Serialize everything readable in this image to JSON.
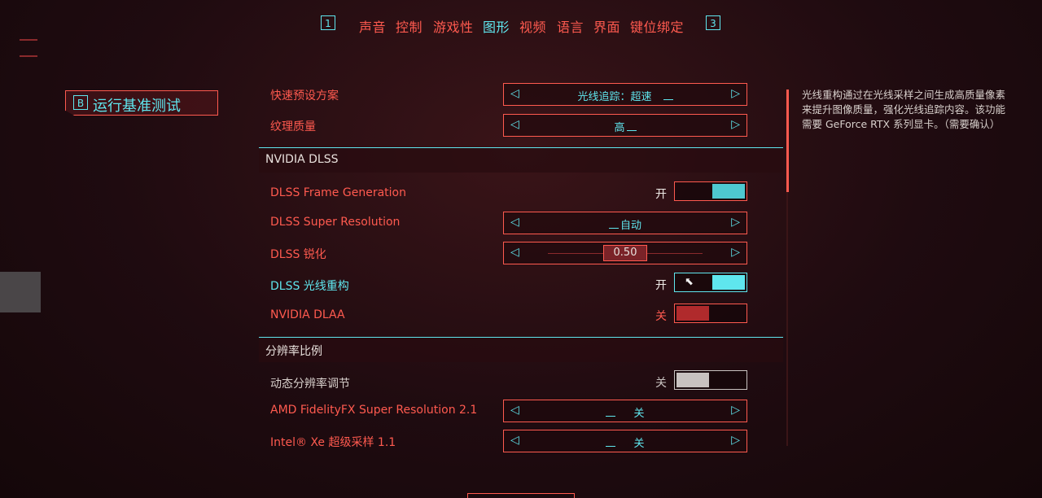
{
  "top_nav": {
    "prev_key": "1",
    "next_key": "3",
    "tabs": [
      {
        "label": "声音"
      },
      {
        "label": "控制"
      },
      {
        "label": "游戏性"
      },
      {
        "label": "图形",
        "active": true
      },
      {
        "label": "视频"
      },
      {
        "label": "语言"
      },
      {
        "label": "界面"
      },
      {
        "label": "键位绑定"
      }
    ]
  },
  "benchmark": {
    "key": "B",
    "label": "运行基准测试"
  },
  "settings": {
    "quick_preset": {
      "label": "快速预设方案",
      "value": "光线追踪：超速"
    },
    "texture_quality": {
      "label": "纹理质量",
      "value": "高"
    },
    "dlss_section": {
      "title": "NVIDIA DLSS"
    },
    "dlss_frame_gen": {
      "label": "DLSS Frame Generation",
      "state": "开"
    },
    "dlss_super_res": {
      "label": "DLSS Super Resolution",
      "value": "自动"
    },
    "dlss_sharpen": {
      "label": "DLSS 锐化",
      "value": "0.50"
    },
    "dlss_ray_recon": {
      "label": "DLSS 光线重构",
      "state": "开"
    },
    "nvidia_dlaa": {
      "label": "NVIDIA DLAA",
      "state": "关"
    },
    "resolution_section": {
      "title": "分辨率比例"
    },
    "dynamic_res": {
      "label": "动态分辨率调节",
      "state": "关"
    },
    "amd_fsr": {
      "label": "AMD FidelityFX Super Resolution 2.1",
      "value": "关"
    },
    "intel_xess": {
      "label": "Intel® Xe 超级采样 1.1",
      "value": "关"
    }
  },
  "description": "光线重构通过在光线采样之间生成高质量像素来提升图像质量，强化光线追踪内容。该功能需要 GeForce RTX 系列显卡。（需要确认）",
  "colors": {
    "accent_red": "#ff5a4f",
    "accent_cyan": "#5fe6ee",
    "background": "#1f0b10"
  }
}
